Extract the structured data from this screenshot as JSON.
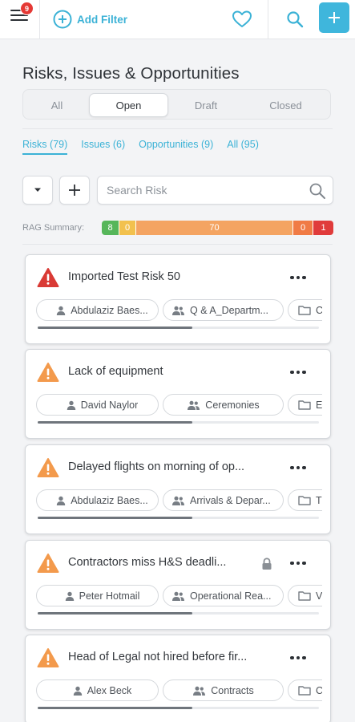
{
  "header": {
    "notification_count": "9",
    "add_filter_label": "Add Filter",
    "accent_color": "#3fb6dc"
  },
  "page_title": "Risks, Issues & Opportunities",
  "status_tabs": [
    {
      "label": "All",
      "active": false
    },
    {
      "label": "Open",
      "active": true
    },
    {
      "label": "Draft",
      "active": false
    },
    {
      "label": "Closed",
      "active": false
    }
  ],
  "type_tabs": [
    {
      "label": "Risks (79)",
      "active": true
    },
    {
      "label": "Issues (6)",
      "active": false
    },
    {
      "label": "Opportunities (9)",
      "active": false
    },
    {
      "label": "All (95)",
      "active": false
    }
  ],
  "search": {
    "placeholder": "Search Risk"
  },
  "rag_summary": {
    "label": "RAG Summary:",
    "segments": [
      {
        "value": "8",
        "color": "#56b65a"
      },
      {
        "value": "0",
        "color": "#f2c14e"
      },
      {
        "value": "70",
        "color": "#f4a462"
      },
      {
        "value": "0",
        "color": "#f07b45"
      },
      {
        "value": "1",
        "color": "#e03b3b"
      }
    ]
  },
  "cards": [
    {
      "title": "Imported Test Risk 50",
      "severity": "high",
      "icon_color": "#d93a35",
      "locked": false,
      "owner": "Abdulaziz Baes...",
      "team": "Q & A_Departm...",
      "folder": "C",
      "progress": 0.55
    },
    {
      "title": "Lack of equipment",
      "severity": "medium",
      "icon_color": "#f39a4c",
      "locked": false,
      "owner": "David Naylor",
      "team": "Ceremonies",
      "folder": "E",
      "progress": 0.55
    },
    {
      "title": "Delayed flights on morning of op...",
      "severity": "medium",
      "icon_color": "#f39a4c",
      "locked": false,
      "owner": "Abdulaziz Baes...",
      "team": "Arrivals & Depar...",
      "folder": "T",
      "progress": 0.55
    },
    {
      "title": "Contractors miss H&S deadli...",
      "severity": "medium",
      "icon_color": "#f39a4c",
      "locked": true,
      "owner": "Peter Hotmail",
      "team": "Operational Rea...",
      "folder": "V",
      "progress": 0.55
    },
    {
      "title": "Head of Legal not hired before fir...",
      "severity": "medium",
      "icon_color": "#f39a4c",
      "locked": false,
      "owner": "Alex Beck",
      "team": "Contracts",
      "folder": "C",
      "progress": 0.55
    }
  ]
}
